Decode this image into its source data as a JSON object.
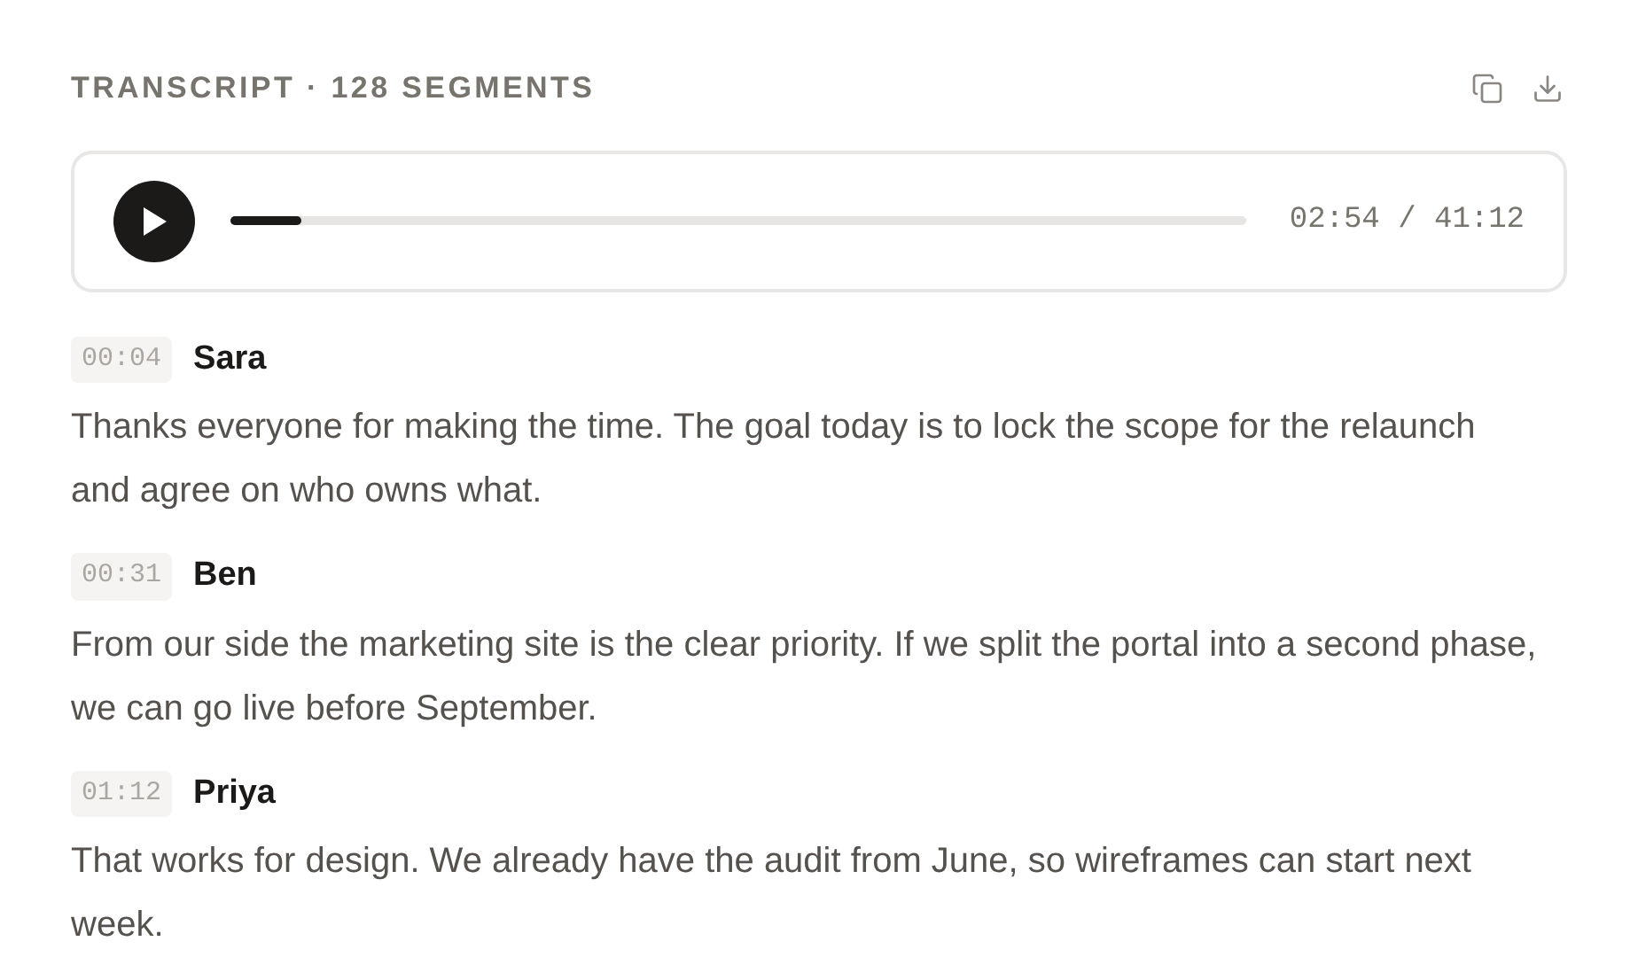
{
  "header": {
    "title": "TRANSCRIPT · 128 SEGMENTS"
  },
  "player": {
    "level": 0.07,
    "time": "02:54 / 41:12"
  },
  "segments": [
    {
      "time": "00:04",
      "speaker": "Sara",
      "text": "Thanks everyone for making the time. The goal today is to lock the scope for the relaunch and agree on who owns what."
    },
    {
      "time": "00:31",
      "speaker": "Ben",
      "text": "From our side the marketing site is the clear priority. If we split the portal into a second phase, we can go live before September."
    },
    {
      "time": "01:12",
      "speaker": "Priya",
      "text": "That works for design. We already have the audit from June, so wireframes can start next week."
    }
  ]
}
